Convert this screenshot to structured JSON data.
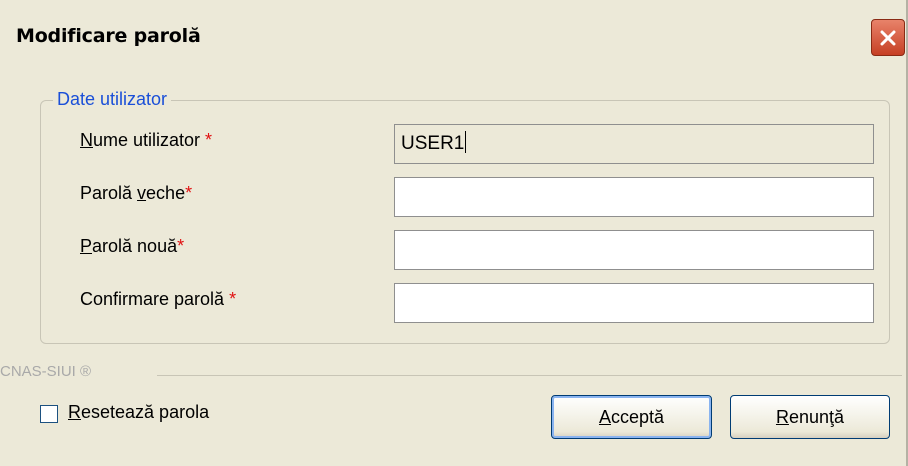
{
  "window": {
    "title": "Modificare parolă",
    "close_icon": "close-icon"
  },
  "group": {
    "legend": "Date utilizator",
    "fields": [
      {
        "label_pre": "",
        "label_underline": "N",
        "label_post": "ume utilizator ",
        "required": "*",
        "value": "USER1",
        "readonly": true
      },
      {
        "label_pre": "Parolă ",
        "label_underline": "v",
        "label_post": "eche",
        "required": "*",
        "value": "",
        "readonly": false
      },
      {
        "label_pre": "",
        "label_underline": "P",
        "label_post": "arolă nouă",
        "required": "*",
        "value": "",
        "readonly": false
      },
      {
        "label_pre": "Confirmare parolă ",
        "label_underline": "",
        "label_post": "",
        "required": "*",
        "value": "",
        "readonly": false
      }
    ]
  },
  "footer": {
    "brand": "CNAS-SIUI ®",
    "reset_checkbox": {
      "underline": "R",
      "rest": "esetează parola",
      "checked": false
    },
    "accept_button": {
      "underline": "A",
      "rest": "cceptă"
    },
    "cancel_button": {
      "underline": "R",
      "rest": "enunţă"
    }
  },
  "colors": {
    "dialog_bg": "#ece9d8",
    "legend": "#1a4fd8",
    "required": "#e01010",
    "close_button": "#c63f24"
  }
}
